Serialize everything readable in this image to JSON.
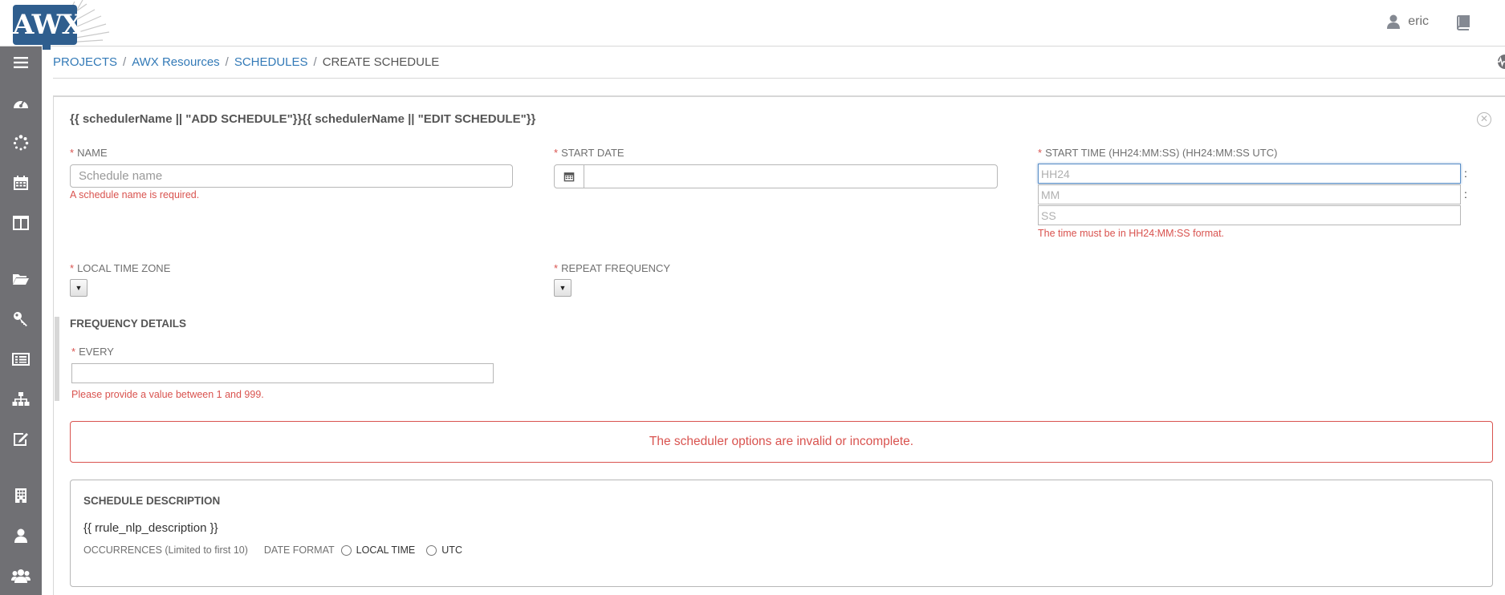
{
  "header": {
    "logo_text": "AWX",
    "username": "eric",
    "user_icon": "user-icon",
    "docs_icon": "book-icon"
  },
  "sidebar": {
    "items": [
      {
        "name": "menu",
        "icon": "hamburger-icon"
      },
      {
        "name": "dashboard",
        "icon": "dashboard-icon"
      },
      {
        "name": "jobs",
        "icon": "spinner-icon"
      },
      {
        "name": "schedules",
        "icon": "calendar-icon"
      },
      {
        "name": "portal",
        "icon": "columns-icon"
      },
      {
        "name": "projects",
        "icon": "folder-icon"
      },
      {
        "name": "credentials",
        "icon": "key-icon"
      },
      {
        "name": "inventories",
        "icon": "list-icon"
      },
      {
        "name": "inventory-scripts",
        "icon": "sitemap-icon"
      },
      {
        "name": "templates",
        "icon": "edit-icon"
      },
      {
        "name": "organizations",
        "icon": "building-icon"
      },
      {
        "name": "users",
        "icon": "user-icon"
      },
      {
        "name": "teams",
        "icon": "users-icon"
      }
    ]
  },
  "breadcrumb": {
    "items": [
      "PROJECTS",
      "AWX Resources",
      "SCHEDULES"
    ],
    "current": "CREATE SCHEDULE",
    "separator": "/"
  },
  "form": {
    "title": "{{ schedulerName || \"ADD SCHEDULE\"}}{{ schedulerName || \"EDIT SCHEDULE\"}}",
    "name_label": "NAME",
    "name_placeholder": "Schedule name",
    "name_error": "A schedule name is required.",
    "start_date_label": "START DATE",
    "start_time_label": "START TIME (HH24:MM:SS) (HH24:MM:SS UTC)",
    "hour_placeholder": "HH24",
    "minute_placeholder": "MM",
    "second_placeholder": "SS",
    "time_colon": ":",
    "time_error": "The time must be in HH24:MM:SS format.",
    "timezone_label": "LOCAL TIME ZONE",
    "repeat_label": "REPEAT FREQUENCY",
    "frequency_title": "FREQUENCY DETAILS",
    "every_label": "EVERY",
    "every_error": "Please provide a value between 1 and 999.",
    "required_mark": "*"
  },
  "alert": {
    "message": "The scheduler options are invalid or incomplete."
  },
  "description": {
    "title": "SCHEDULE DESCRIPTION",
    "nlp": "{{ rrule_nlp_description }}",
    "occurrences_label": "OCCURRENCES (Limited to first 10)",
    "date_format_label": "DATE FORMAT",
    "local_time_label": "LOCAL TIME",
    "utc_label": "UTC"
  },
  "colors": {
    "sidebar": "#707074",
    "link": "#337ab7",
    "error": "#d9534f",
    "logo": "#2f5e8e"
  }
}
